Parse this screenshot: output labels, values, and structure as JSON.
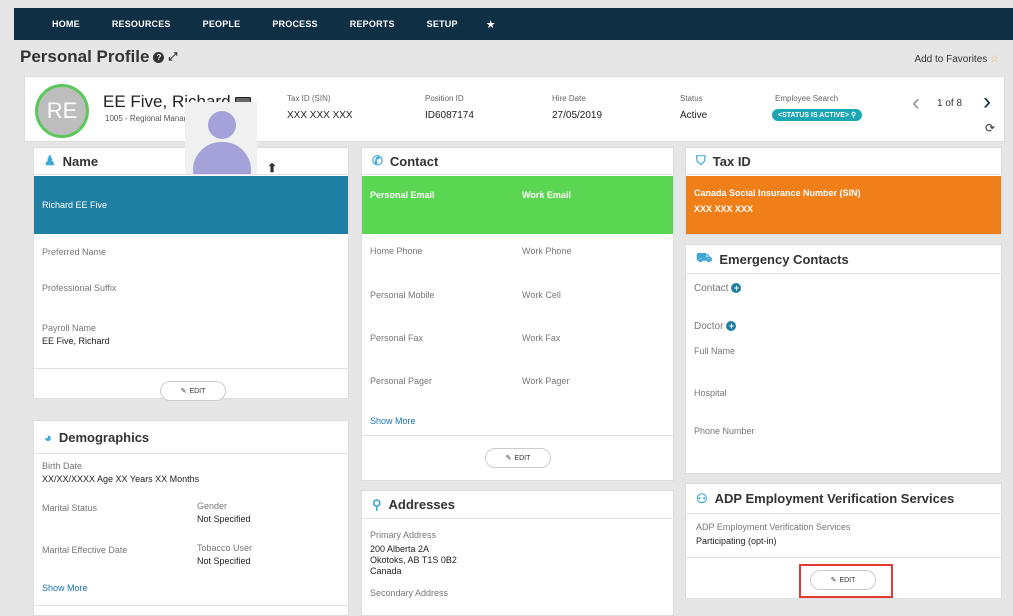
{
  "nav": {
    "items": [
      "HOME",
      "RESOURCES",
      "PEOPLE",
      "PROCESS",
      "REPORTS",
      "SETUP"
    ]
  },
  "header": {
    "title": "Personal Profile",
    "add_favorites": "Add to Favorites"
  },
  "profile": {
    "initials": "RE",
    "name": "EE Five, Richard",
    "subtitle": "1005 - Regional Manager",
    "fields": [
      {
        "label": "Tax ID (SIN)",
        "value": "XXX XXX XXX"
      },
      {
        "label": "Position ID",
        "value": "ID6087174"
      },
      {
        "label": "Hire Date",
        "value": "27/05/2019"
      },
      {
        "label": "Status",
        "value": "Active"
      }
    ],
    "employee_search_label": "Employee Search",
    "employee_search_badge": "<STATUS IS ACTIVE>",
    "pager": "1 of 8"
  },
  "name_card": {
    "title": "Name",
    "full_name": "Richard EE Five",
    "preferred_label": "Preferred Name",
    "suffix_label": "Professional Suffix",
    "payroll_label": "Payroll Name",
    "payroll_value": "EE Five, Richard",
    "edit": "EDIT"
  },
  "demographics": {
    "title": "Demographics",
    "birth_label": "Birth Date",
    "birth_value": "XX/XX/XXXX Age XX Years XX Months",
    "marital_label": "Marital Status",
    "gender_label": "Gender",
    "gender_value": "Not Specified",
    "marital_eff_label": "Marital Effective Date",
    "tobacco_label": "Tobacco User",
    "tobacco_value": "Not Specified",
    "show_more": "Show More"
  },
  "contact": {
    "title": "Contact",
    "personal_email": "Personal Email",
    "work_email": "Work Email",
    "home_phone": "Home Phone",
    "work_phone": "Work Phone",
    "personal_mobile": "Personal Mobile",
    "work_cell": "Work Cell",
    "personal_fax": "Personal Fax",
    "work_fax": "Work Fax",
    "personal_pager": "Personal Pager",
    "work_pager": "Work Pager",
    "show_more": "Show More",
    "edit": "EDIT"
  },
  "addresses": {
    "title": "Addresses",
    "primary_label": "Primary Address",
    "line1": "200 Alberta 2A",
    "line2": "Okotoks, AB T1S 0B2",
    "line3": "Canada",
    "secondary_label": "Secondary Address"
  },
  "taxid": {
    "title": "Tax ID",
    "sin_label": "Canada Social Insurance Number (SIN)",
    "sin_value": "XXX XXX XXX"
  },
  "emergency": {
    "title": "Emergency Contacts",
    "contact": "Contact",
    "doctor": "Doctor",
    "full_name": "Full Name",
    "hospital": "Hospital",
    "phone": "Phone Number"
  },
  "adp": {
    "title": "ADP Employment Verification Services",
    "label": "ADP Employment Verification Services",
    "value": "Participating (opt-in)",
    "edit": "EDIT"
  },
  "colors": {
    "nav": "#0e2f44",
    "name_band": "#1f7fa3",
    "contact_band": "#5ad652",
    "tax_band": "#f07f19",
    "avatar_ring": "#5ac85a",
    "highlight": "#e53935"
  }
}
